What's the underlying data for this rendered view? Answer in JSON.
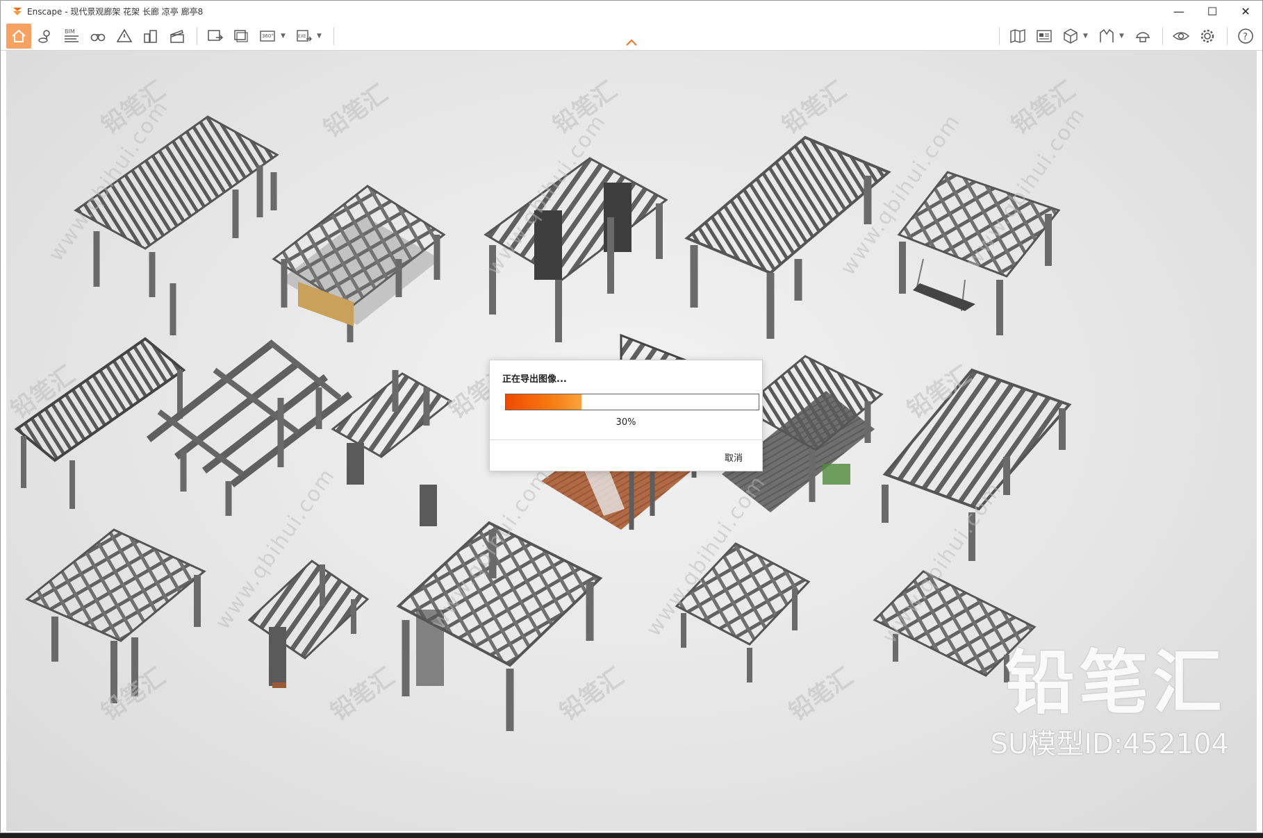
{
  "window": {
    "title": "Enscape - 现代景观廊架 花架 长廊 凉亭 廊亭8",
    "controls": {
      "minimize": "—",
      "maximize": "☐",
      "close": "✕"
    }
  },
  "toolbar": {
    "left_buttons": [
      {
        "name": "home-icon",
        "label": "Home"
      },
      {
        "name": "location-icon",
        "label": "Sun / Location"
      },
      {
        "name": "bim-icon",
        "label": "BIM"
      },
      {
        "name": "binoculars-icon",
        "label": "Views"
      },
      {
        "name": "warning-icon",
        "label": "Issues"
      },
      {
        "name": "buildings-icon",
        "label": "Site"
      },
      {
        "name": "clapper-icon",
        "label": "Video"
      },
      {
        "name": "render-image-icon",
        "label": "Render Image"
      },
      {
        "name": "batch-render-icon",
        "label": "Batch Render"
      },
      {
        "name": "panorama-360-icon",
        "label": "360"
      },
      {
        "name": "exe-export-icon",
        "label": "EXE"
      }
    ],
    "bim_label": "BIM",
    "pano_label": "360°",
    "exe_label": "EXE",
    "right_buttons": [
      {
        "name": "map-icon"
      },
      {
        "name": "asset-library-icon"
      },
      {
        "name": "cube-icon"
      },
      {
        "name": "section-icon"
      },
      {
        "name": "hat-icon"
      },
      {
        "name": "eye-icon"
      },
      {
        "name": "gear-icon"
      },
      {
        "name": "help-icon"
      }
    ],
    "help_label": "?"
  },
  "dialog": {
    "title": "正在导出图像...",
    "progress": 30,
    "progress_label": "30%",
    "cancel_label": "取消",
    "accent": "#f25a06"
  },
  "watermark": {
    "brand": "铅笔汇",
    "model_id": "SU模型ID:452104",
    "url": "www.qbihui.com"
  }
}
